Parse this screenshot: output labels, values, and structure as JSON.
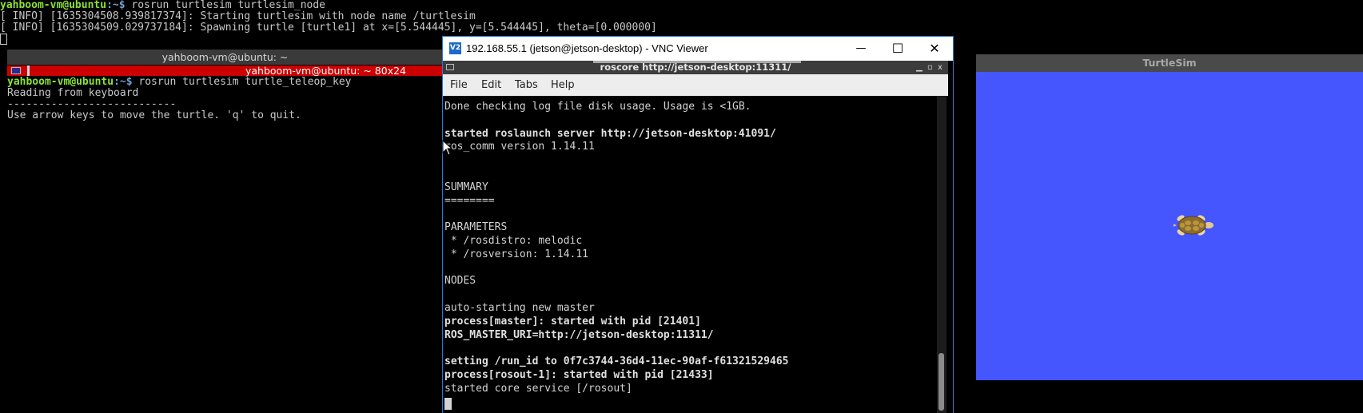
{
  "background_terminal": {
    "lines": [
      {
        "prompt_user": "yahboom-vm@ubuntu",
        "prompt_path": ":~$ ",
        "cmd": "rosrun turtlesim turtlesim_node"
      },
      {
        "text": "[ INFO] [1635304508.939817374]: Starting turtlesim with node name /turtlesim"
      },
      {
        "text": "[ INFO] [1635304509.029737184]: Spawning turtle [turtle1] at x=[5.544445], y=[5.544445], theta=[0.000000]"
      }
    ]
  },
  "teleop_terminal": {
    "window_title": "yahboom-vm@ubuntu: ~",
    "tab_label": "yahboom-vm@ubuntu: ~ 80x24",
    "lines": [
      {
        "prompt_user": "yahboom-vm@ubuntu",
        "prompt_path": ":~$ ",
        "cmd": "rosrun turtlesim turtle_teleop_key"
      },
      {
        "text": "Reading from keyboard"
      },
      {
        "text": "---------------------------"
      },
      {
        "text": "Use arrow keys to move the turtle. 'q' to quit."
      }
    ]
  },
  "vnc_viewer": {
    "logo": "V2",
    "title": "192.168.55.1 (jetson@jetson-desktop) - VNC Viewer",
    "controls": {
      "minimize": "—",
      "maximize": "☐",
      "close": "✕"
    },
    "roscore_window": {
      "title": "roscore http://jetson-desktop:11311/",
      "controls": {
        "minimize": "▁",
        "maximize": "▫",
        "close": "x"
      },
      "menu": [
        "File",
        "Edit",
        "Tabs",
        "Help"
      ],
      "lines": [
        {
          "text": "Done checking log file disk usage. Usage is <1GB.",
          "bold": false
        },
        {
          "text": "",
          "bold": false
        },
        {
          "text": "started roslaunch server http://jetson-desktop:41091/",
          "bold": true
        },
        {
          "text": "ros_comm version 1.14.11",
          "bold": false
        },
        {
          "text": "",
          "bold": false
        },
        {
          "text": "",
          "bold": false
        },
        {
          "text": "SUMMARY",
          "bold": false
        },
        {
          "text": "========",
          "bold": false
        },
        {
          "text": "",
          "bold": false
        },
        {
          "text": "PARAMETERS",
          "bold": false
        },
        {
          "text": " * /rosdistro: melodic",
          "bold": false
        },
        {
          "text": " * /rosversion: 1.14.11",
          "bold": false
        },
        {
          "text": "",
          "bold": false
        },
        {
          "text": "NODES",
          "bold": false
        },
        {
          "text": "",
          "bold": false
        },
        {
          "text": "auto-starting new master",
          "bold": false
        },
        {
          "text": "process[master]: started with pid [21401]",
          "bold": true
        },
        {
          "text": "ROS_MASTER_URI=http://jetson-desktop:11311/",
          "bold": true
        },
        {
          "text": "",
          "bold": false
        },
        {
          "text": "setting /run_id to 0f7c3744-36d4-11ec-90af-f61321529465",
          "bold": true
        },
        {
          "text": "process[rosout-1]: started with pid [21433]",
          "bold": true
        },
        {
          "text": "started core service [/rosout]",
          "bold": false
        }
      ]
    }
  },
  "turtlesim": {
    "title": "TurtleSim",
    "background_color": "#4556ff"
  },
  "colors": {
    "prompt_green": "#8ae234",
    "prompt_blue": "#729fcf",
    "tab_red": "#cc0000"
  }
}
